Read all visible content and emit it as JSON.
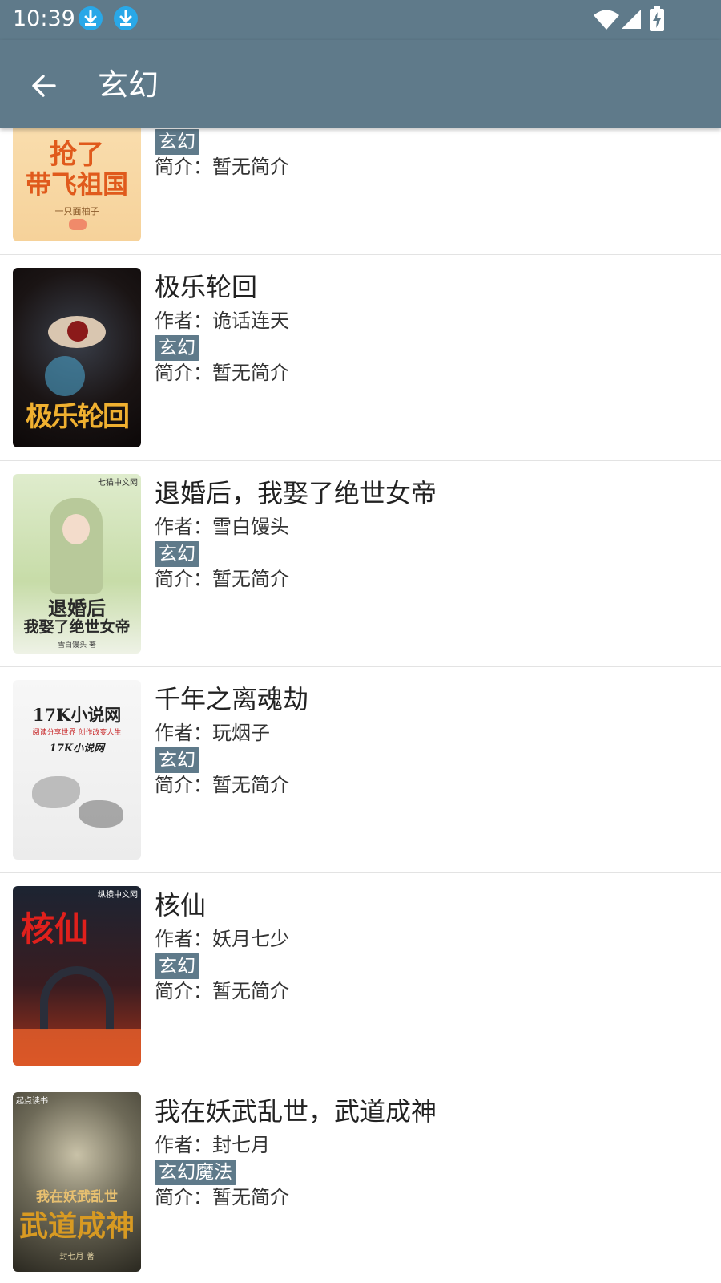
{
  "status_bar": {
    "time": "10:39",
    "icons": [
      "download-icon",
      "download-icon",
      "wifi-icon",
      "cellular-signal-icon",
      "battery-charging-icon"
    ]
  },
  "app_bar": {
    "back_icon": "arrow-back-icon",
    "title": "玄幻"
  },
  "colors": {
    "primary": "#5f7a8a",
    "tag_background": "#5f7a8a",
    "download_badge": "#29a8e8",
    "divider": "#e3e3e3"
  },
  "labels": {
    "author_prefix": "作者：",
    "intro_prefix": "简介："
  },
  "books": [
    {
      "title": "",
      "author": "",
      "tag": "玄幻",
      "intro": "暂无简介",
      "cover_text": [
        "抢了",
        "带飞祖国",
        "一只面柚子"
      ]
    },
    {
      "title": "极乐轮回",
      "author": "诡话连天",
      "tag": "玄幻",
      "intro": "暂无简介",
      "cover_text": [
        "极乐轮回"
      ]
    },
    {
      "title": "退婚后，我娶了绝世女帝",
      "author": "雪白馒头",
      "tag": "玄幻",
      "intro": "暂无简介",
      "cover_text": [
        "七猫中文网",
        "退婚后",
        "我娶了绝世女帝",
        "雪白馒头 著"
      ]
    },
    {
      "title": "千年之离魂劫",
      "author": "玩烟子",
      "tag": "玄幻",
      "intro": "暂无简介",
      "cover_text": [
        "17K小说网",
        "阅读分享世界 创作改变人生",
        "17K小说网"
      ]
    },
    {
      "title": "核仙",
      "author": "妖月七少",
      "tag": "玄幻",
      "intro": "暂无简介",
      "cover_text": [
        "纵横中文网",
        "核仙"
      ]
    },
    {
      "title": "我在妖武乱世，武道成神",
      "author": "封七月",
      "tag": "玄幻魔法",
      "intro": "暂无简介",
      "cover_text": [
        "起点读书",
        "我在妖武乱世",
        "武道成神",
        "封七月 著"
      ]
    }
  ]
}
